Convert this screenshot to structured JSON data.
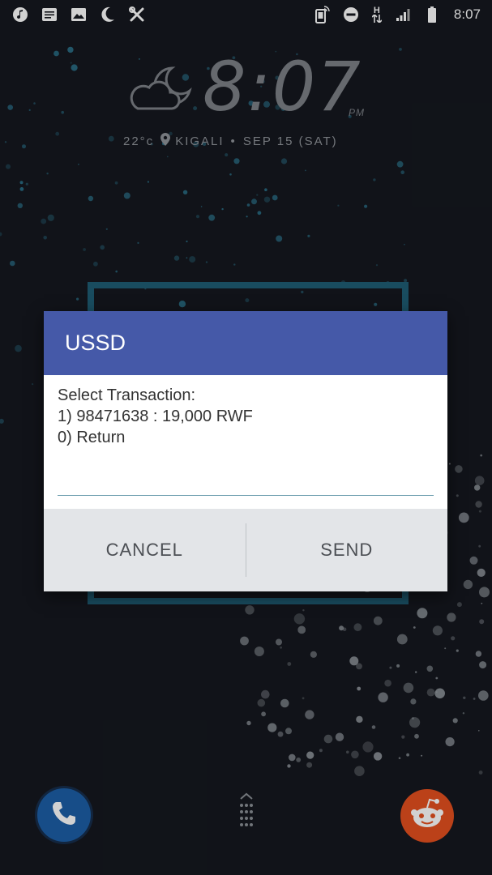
{
  "status_bar": {
    "time": "8:07",
    "left_icons": [
      "music-note-icon",
      "notes-icon",
      "image-icon",
      "moon-icon",
      "tools-icon"
    ],
    "right_icons": [
      "screencast-icon",
      "do-not-disturb-icon",
      "data-arrows-icon",
      "signal-icon",
      "battery-icon"
    ],
    "network_label": "H"
  },
  "clock_widget": {
    "time": "8:07",
    "ampm": "PM",
    "temperature": "22°c",
    "location": "KIGALI",
    "separator": "•",
    "date": "SEP 15 (SAT)",
    "weather_icon": "partly-cloudy-night-icon"
  },
  "dialog": {
    "title": "USSD",
    "message_lines": [
      "Select Transaction:",
      "1) 98471638 : 19,000 RWF",
      "0) Return"
    ],
    "input_value": "",
    "input_placeholder": "",
    "cancel_label": "CANCEL",
    "send_label": "SEND"
  },
  "dock": {
    "left_app_icon": "phone-icon",
    "center_icon": "app-drawer-icon",
    "right_app_icon": "reddit-icon"
  },
  "colors": {
    "dialog_header": "#4559a8",
    "dialog_actions_bg": "#e3e5e8",
    "wallpaper": "#15181f",
    "accent_teal": "#2b6f87",
    "phone_app": "#1d5fa6",
    "reddit_app": "#e5501f"
  }
}
